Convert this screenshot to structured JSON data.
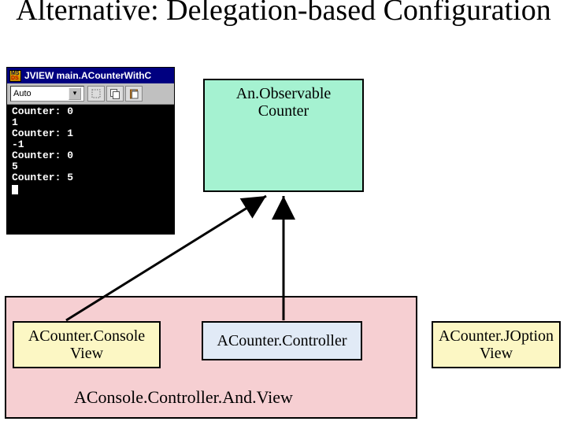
{
  "title": "Alternative: Delegation-based\nConfiguration",
  "console": {
    "window_title": "JVIEW main.ACounterWithC",
    "combo_value": "Auto",
    "lines": [
      "Counter: 0",
      "1",
      "Counter: 1",
      "-1",
      "Counter: 0",
      "5",
      "Counter: 5"
    ]
  },
  "boxes": {
    "observable": "An.Observable\nCounter",
    "console_view": "ACounter.Console\nView",
    "controller": "ACounter.Controller",
    "joption": "ACounter.JOption\nView",
    "pink_label": "AConsole.Controller.And.View"
  }
}
